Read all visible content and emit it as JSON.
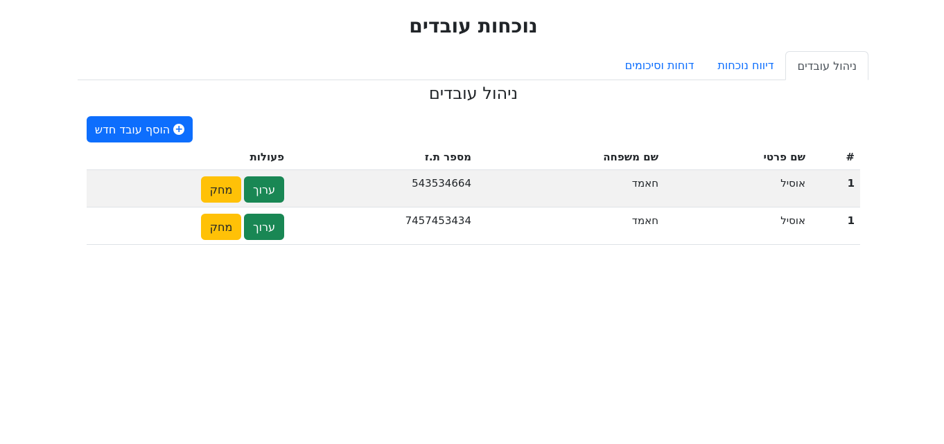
{
  "header": {
    "title": "נוכחות עובדים"
  },
  "tabs": [
    {
      "label": "ניהול עובדים",
      "active": true
    },
    {
      "label": "דיווח נוכחות",
      "active": false
    },
    {
      "label": "דוחות וסיכומים",
      "active": false
    }
  ],
  "section": {
    "title": "ניהול עובדים",
    "add_button_label": "הוסף עובד חדש",
    "add_button_icon": "plus-circle-icon"
  },
  "table": {
    "headers": {
      "num": "#",
      "first_name": "שם פרטי",
      "last_name": "שם משפחה",
      "id_number": "מספר ת.ז",
      "actions": "פעולות"
    },
    "rows": [
      {
        "num": "1",
        "first_name": "אוסיל",
        "last_name": "חאמד",
        "id_number": "543534664",
        "edit_label": "ערוך",
        "delete_label": "מחק"
      },
      {
        "num": "1",
        "first_name": "אוסיל",
        "last_name": "חאמד",
        "id_number": "7457453434",
        "edit_label": "ערוך",
        "delete_label": "מחק"
      }
    ]
  },
  "colors": {
    "primary": "#0d6efd",
    "success": "#198754",
    "warning": "#ffc107",
    "stripe": "#f2f2f2"
  }
}
